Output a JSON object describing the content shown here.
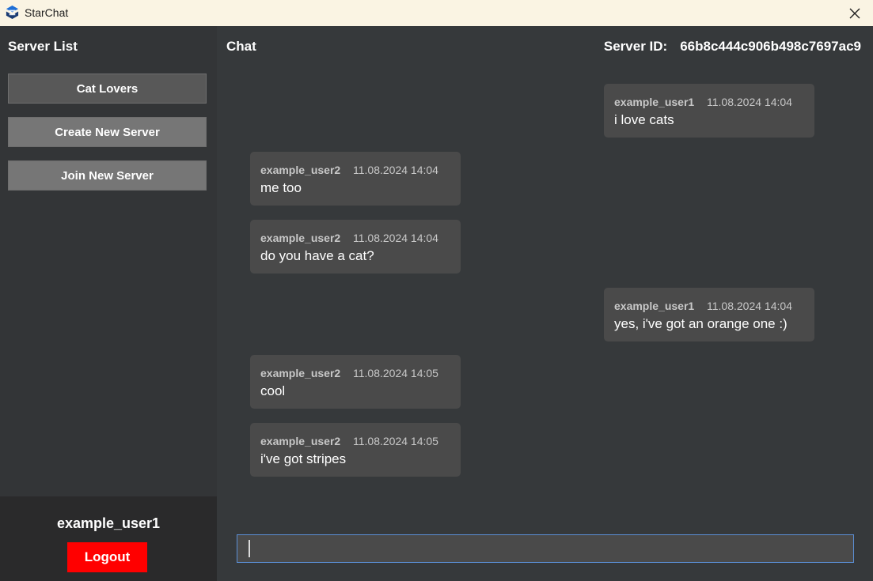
{
  "window": {
    "title": "StarChat",
    "close_icon": "close-icon",
    "logo_icon": "starchat-logo-icon"
  },
  "sidebar": {
    "title": "Server List",
    "servers": [
      "Cat Lovers"
    ],
    "create_label": "Create New Server",
    "join_label": "Join New Server",
    "username": "example_user1",
    "logout_label": "Logout"
  },
  "chat": {
    "title": "Chat",
    "server_id_label": "Server ID:",
    "server_id": "66b8c444c906b498c7697ac9",
    "messages": [
      {
        "author": "example_user1",
        "time": "11.08.2024 14:04",
        "text": "i love cats"
      },
      {
        "author": "example_user2",
        "time": "11.08.2024 14:04",
        "text": "me too"
      },
      {
        "author": "example_user2",
        "time": "11.08.2024 14:04",
        "text": "do you have a cat?"
      },
      {
        "author": "example_user1",
        "time": "11.08.2024 14:04",
        "text": "yes, i've got an orange one :)"
      },
      {
        "author": "example_user2",
        "time": "11.08.2024 14:05",
        "text": "cool"
      },
      {
        "author": "example_user2",
        "time": "11.08.2024 14:05",
        "text": "i've got stripes"
      }
    ],
    "input_value": ""
  },
  "colors": {
    "logout": "#ff0000",
    "background": "#36393b",
    "sidebar": "#333537",
    "bubble": "#4a4a4a",
    "input_border": "#5b8fd6"
  }
}
